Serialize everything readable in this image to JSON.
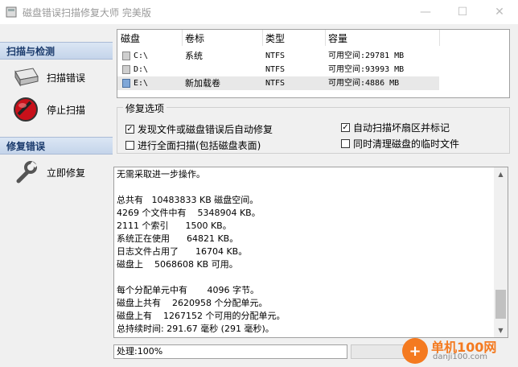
{
  "window": {
    "title": "磁盘错误扫描修复大师 完美版",
    "minimize": "—",
    "maximize": "☐",
    "close": "✕"
  },
  "sidebar": {
    "section1": "扫描与检测",
    "scan_error": "扫描错误",
    "stop_scan": "停止扫描",
    "section2": "修复错误",
    "repair_now": "立即修复"
  },
  "drives": {
    "columns": [
      "磁盘",
      "卷标",
      "类型",
      "容量"
    ],
    "rows": [
      {
        "disk": "C:\\",
        "label": "系统",
        "type": "NTFS",
        "capacity": "可用空间:29781 MB"
      },
      {
        "disk": "D:\\",
        "label": "",
        "type": "NTFS",
        "capacity": "可用空间:93993 MB"
      },
      {
        "disk": "E:\\",
        "label": "新加载卷",
        "type": "NTFS",
        "capacity": "可用空间:4886 MB"
      }
    ]
  },
  "options": {
    "title": "修复选项",
    "auto_fix": "发现文件或磁盘错误后自动修复",
    "full_scan": "进行全面扫描(包括磁盘表面)",
    "mark_bad": "自动扫描坏扇区并标记",
    "clean_temp": "同时清理磁盘的临时文件",
    "auto_fix_checked": true,
    "full_scan_checked": false,
    "mark_bad_checked": true,
    "clean_temp_checked": false
  },
  "log": {
    "lines": [
      "无需采取进一步操作。",
      "",
      "总共有   10483833 KB 磁盘空间。",
      "4269 个文件中有    5348904 KB。",
      "2111 个索引      1500 KB。",
      "系统正在使用      64821 KB。",
      "日志文件占用了      16704 KB。",
      "磁盘上    5068608 KB 可用。",
      "",
      "每个分配单元中有       4096 字节。",
      "磁盘上共有    2620958 个分配单元。",
      "磁盘上有    1267152 个可用的分配单元。",
      "总持续时间: 291.67 毫秒 (291 毫秒)。"
    ]
  },
  "status": {
    "text": "处理:100%"
  },
  "watermark": {
    "name": "单机100网",
    "url": "danji100.com",
    "symbol": "+"
  }
}
